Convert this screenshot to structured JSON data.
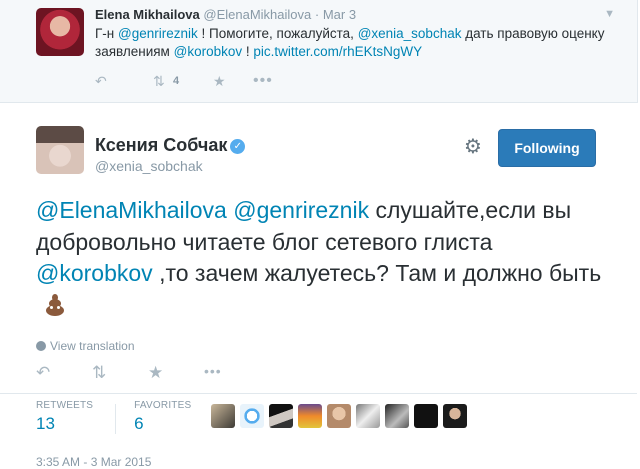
{
  "parent_tweet": {
    "name": "Elena Mikhailova",
    "handle": "@ElenaMikhailova",
    "dot": "·",
    "time": "Mar 3",
    "text_parts": [
      "Г-н ",
      "@genrireznik",
      " ! Помогите, пожалуйста, ",
      "@xenia_sobchak",
      " дать правовую оценку заявлениям ",
      "@korobkov",
      " ! ",
      "pic.twitter.com/rhEKtsNgWY"
    ],
    "retweet_count": "4"
  },
  "main_tweet": {
    "name": "Ксения Собчак",
    "handle": "@xenia_sobchak",
    "follow_label": "Following",
    "text_parts": [
      "@ElenaMikhailova",
      " ",
      "@genrireznik",
      " слушайте,если вы добровольно читаете блог сетевого глиста ",
      "@korobkov",
      " ,то зачем жалуетесь? Там и должно быть"
    ],
    "view_translation": "View translation",
    "retweets_label": "RETWEETS",
    "retweets": "13",
    "favorites_label": "FAVORITES",
    "favorites": "6",
    "timestamp": "3:35 AM - 3 Mar 2015"
  },
  "icons": {
    "reply": "reply-icon",
    "retweet": "retweet-icon",
    "favorite": "star-icon",
    "more": "more-icon",
    "gear": "gear-icon",
    "verified": "verified-badge-icon",
    "globe": "globe-icon"
  },
  "colors": {
    "link": "#0084b4",
    "follow_button": "#2b7bb9",
    "muted": "#8899a6",
    "parent_bg": "#f5f8fa"
  }
}
